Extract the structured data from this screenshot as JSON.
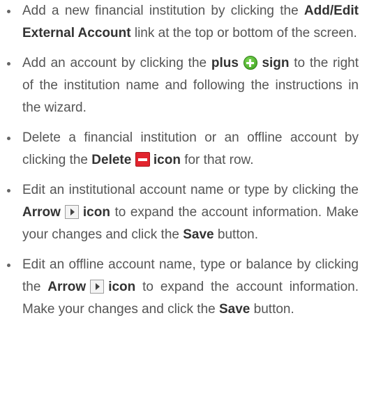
{
  "items": [
    {
      "pre": "Add a new financial institution by clicking the ",
      "bold1": "Add/Edit External Account",
      "post": " link at the top or bottom of the screen."
    },
    {
      "pre": "Add an account by clicking the ",
      "bold1": "plus",
      "icon": "plus-circle-icon",
      "bold2": "sign",
      "post": " to the right of the institution name and following the instructions in the wizard."
    },
    {
      "pre": "Delete a financial institution or an offline account by clicking the ",
      "bold1": "Delete",
      "icon": "delete-icon",
      "bold2": "icon",
      "post": " for that row."
    },
    {
      "pre": "Edit an institutional account name or type by clicking the ",
      "bold1": "Arrow",
      "icon": "arrow-right-icon",
      "bold2": "icon",
      "mid": " to expand the account information. Make your changes and click the ",
      "bold3": "Save",
      "post": " button."
    },
    {
      "pre": "Edit an offline account name, type or balance by clicking the ",
      "bold1": "Arrow",
      "icon": "arrow-right-icon",
      "bold2": "icon",
      "mid": " to expand the account information. Make your changes and click the ",
      "bold3": "Save",
      "post": " button."
    }
  ],
  "colors": {
    "text": "#555555",
    "bold": "#333333",
    "plus_icon": "#3a9d1e",
    "delete_icon": "#e2242e"
  }
}
